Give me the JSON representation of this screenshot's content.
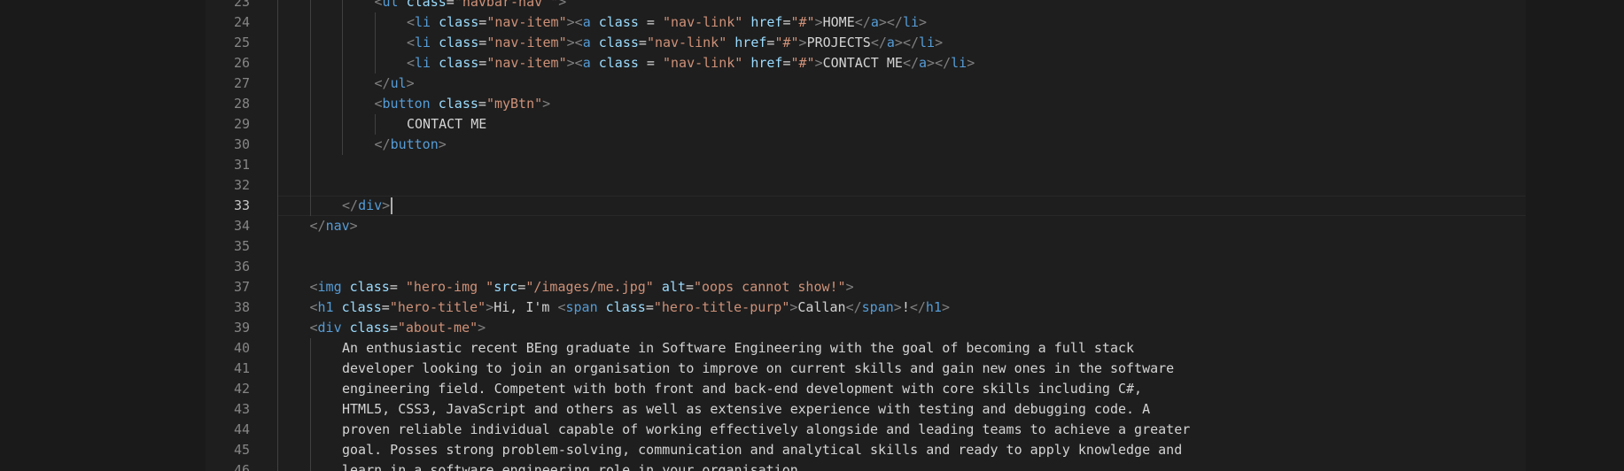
{
  "theme": {
    "background": "#1e1e1e",
    "side_background": "#1a1a1a",
    "line_number": "#858585",
    "line_number_active": "#c6c6c6",
    "indent_guide": "#404040",
    "colors": {
      "p": "#808080",
      "t": "#569cd6",
      "a": "#9cdcfe",
      "s": "#ce9178",
      "x": "#d4d4d4"
    }
  },
  "editor": {
    "active_line": "33",
    "lines": [
      {
        "num": "23",
        "indent": 3,
        "tokens": [
          [
            "p",
            "<"
          ],
          [
            "t",
            "ul"
          ],
          [
            "x",
            " "
          ],
          [
            "a",
            "class"
          ],
          [
            "x",
            "="
          ],
          [
            "s",
            "\"navbar-nav \""
          ],
          [
            "p",
            ">"
          ]
        ]
      },
      {
        "num": "24",
        "indent": 4,
        "tokens": [
          [
            "p",
            "<"
          ],
          [
            "t",
            "li"
          ],
          [
            "x",
            " "
          ],
          [
            "a",
            "class"
          ],
          [
            "x",
            "="
          ],
          [
            "s",
            "\"nav-item\""
          ],
          [
            "p",
            ">"
          ],
          [
            "p",
            "<"
          ],
          [
            "t",
            "a"
          ],
          [
            "x",
            " "
          ],
          [
            "a",
            "class"
          ],
          [
            "x",
            " = "
          ],
          [
            "s",
            "\"nav-link\""
          ],
          [
            "x",
            " "
          ],
          [
            "a",
            "href"
          ],
          [
            "x",
            "="
          ],
          [
            "s",
            "\"#\""
          ],
          [
            "p",
            ">"
          ],
          [
            "x",
            "HOME"
          ],
          [
            "p",
            "</"
          ],
          [
            "t",
            "a"
          ],
          [
            "p",
            ">"
          ],
          [
            "p",
            "</"
          ],
          [
            "t",
            "li"
          ],
          [
            "p",
            ">"
          ]
        ]
      },
      {
        "num": "25",
        "indent": 4,
        "tokens": [
          [
            "p",
            "<"
          ],
          [
            "t",
            "li"
          ],
          [
            "x",
            " "
          ],
          [
            "a",
            "class"
          ],
          [
            "x",
            "="
          ],
          [
            "s",
            "\"nav-item\""
          ],
          [
            "p",
            ">"
          ],
          [
            "p",
            "<"
          ],
          [
            "t",
            "a"
          ],
          [
            "x",
            " "
          ],
          [
            "a",
            "class"
          ],
          [
            "x",
            "="
          ],
          [
            "s",
            "\"nav-link\""
          ],
          [
            "x",
            " "
          ],
          [
            "a",
            "href"
          ],
          [
            "x",
            "="
          ],
          [
            "s",
            "\"#\""
          ],
          [
            "p",
            ">"
          ],
          [
            "x",
            "PROJECTS"
          ],
          [
            "p",
            "</"
          ],
          [
            "t",
            "a"
          ],
          [
            "p",
            ">"
          ],
          [
            "p",
            "</"
          ],
          [
            "t",
            "li"
          ],
          [
            "p",
            ">"
          ]
        ]
      },
      {
        "num": "26",
        "indent": 4,
        "tokens": [
          [
            "p",
            "<"
          ],
          [
            "t",
            "li"
          ],
          [
            "x",
            " "
          ],
          [
            "a",
            "class"
          ],
          [
            "x",
            "="
          ],
          [
            "s",
            "\"nav-item\""
          ],
          [
            "p",
            ">"
          ],
          [
            "p",
            "<"
          ],
          [
            "t",
            "a"
          ],
          [
            "x",
            " "
          ],
          [
            "a",
            "class"
          ],
          [
            "x",
            " = "
          ],
          [
            "s",
            "\"nav-link\""
          ],
          [
            "x",
            " "
          ],
          [
            "a",
            "href"
          ],
          [
            "x",
            "="
          ],
          [
            "s",
            "\"#\""
          ],
          [
            "p",
            ">"
          ],
          [
            "x",
            "CONTACT ME"
          ],
          [
            "p",
            "</"
          ],
          [
            "t",
            "a"
          ],
          [
            "p",
            ">"
          ],
          [
            "p",
            "</"
          ],
          [
            "t",
            "li"
          ],
          [
            "p",
            ">"
          ]
        ]
      },
      {
        "num": "27",
        "indent": 3,
        "tokens": [
          [
            "p",
            "</"
          ],
          [
            "t",
            "ul"
          ],
          [
            "p",
            ">"
          ]
        ]
      },
      {
        "num": "28",
        "indent": 3,
        "tokens": [
          [
            "p",
            "<"
          ],
          [
            "t",
            "button"
          ],
          [
            "x",
            " "
          ],
          [
            "a",
            "class"
          ],
          [
            "x",
            "="
          ],
          [
            "s",
            "\"myBtn\""
          ],
          [
            "p",
            ">"
          ]
        ]
      },
      {
        "num": "29",
        "indent": 4,
        "tokens": [
          [
            "x",
            "CONTACT ME"
          ]
        ]
      },
      {
        "num": "30",
        "indent": 3,
        "tokens": [
          [
            "p",
            "</"
          ],
          [
            "t",
            "button"
          ],
          [
            "p",
            ">"
          ]
        ]
      },
      {
        "num": "31",
        "indent": 0,
        "tokens": []
      },
      {
        "num": "32",
        "indent": 0,
        "tokens": []
      },
      {
        "num": "33",
        "indent": 2,
        "tokens": [
          [
            "p",
            "</"
          ],
          [
            "t",
            "div"
          ],
          [
            "p",
            ">"
          ]
        ]
      },
      {
        "num": "34",
        "indent": 1,
        "tokens": [
          [
            "p",
            "</"
          ],
          [
            "t",
            "nav"
          ],
          [
            "p",
            ">"
          ]
        ]
      },
      {
        "num": "35",
        "indent": 0,
        "tokens": []
      },
      {
        "num": "36",
        "indent": 0,
        "tokens": []
      },
      {
        "num": "37",
        "indent": 1,
        "tokens": [
          [
            "p",
            "<"
          ],
          [
            "t",
            "img"
          ],
          [
            "x",
            " "
          ],
          [
            "a",
            "class"
          ],
          [
            "x",
            "= "
          ],
          [
            "s",
            "\"hero-img \""
          ],
          [
            "a",
            "src"
          ],
          [
            "x",
            "="
          ],
          [
            "s",
            "\"/images/me.jpg\""
          ],
          [
            "x",
            " "
          ],
          [
            "a",
            "alt"
          ],
          [
            "x",
            "="
          ],
          [
            "s",
            "\"oops cannot show!\""
          ],
          [
            "p",
            ">"
          ]
        ]
      },
      {
        "num": "38",
        "indent": 1,
        "tokens": [
          [
            "p",
            "<"
          ],
          [
            "t",
            "h1"
          ],
          [
            "x",
            " "
          ],
          [
            "a",
            "class"
          ],
          [
            "x",
            "="
          ],
          [
            "s",
            "\"hero-title\""
          ],
          [
            "p",
            ">"
          ],
          [
            "x",
            "Hi, I'm "
          ],
          [
            "p",
            "<"
          ],
          [
            "t",
            "span"
          ],
          [
            "x",
            " "
          ],
          [
            "a",
            "class"
          ],
          [
            "x",
            "="
          ],
          [
            "s",
            "\"hero-title-purp\""
          ],
          [
            "p",
            ">"
          ],
          [
            "x",
            "Callan"
          ],
          [
            "p",
            "</"
          ],
          [
            "t",
            "span"
          ],
          [
            "p",
            ">"
          ],
          [
            "x",
            "!"
          ],
          [
            "p",
            "</"
          ],
          [
            "t",
            "h1"
          ],
          [
            "p",
            ">"
          ]
        ]
      },
      {
        "num": "39",
        "indent": 1,
        "tokens": [
          [
            "p",
            "<"
          ],
          [
            "t",
            "div"
          ],
          [
            "x",
            " "
          ],
          [
            "a",
            "class"
          ],
          [
            "x",
            "="
          ],
          [
            "s",
            "\"about-me\""
          ],
          [
            "p",
            ">"
          ]
        ]
      },
      {
        "num": "40",
        "indent": 2,
        "tokens": [
          [
            "x",
            "An enthusiastic recent BEng graduate in Software Engineering with the goal of becoming a full stack"
          ]
        ]
      },
      {
        "num": "41",
        "indent": 2,
        "tokens": [
          [
            "x",
            "developer looking to join an organisation to improve on current skills and gain new ones in the software"
          ]
        ]
      },
      {
        "num": "42",
        "indent": 2,
        "tokens": [
          [
            "x",
            "engineering field. Competent with both front and back-end development with core skills including C#,"
          ]
        ]
      },
      {
        "num": "43",
        "indent": 2,
        "tokens": [
          [
            "x",
            "HTML5, CSS3, JavaScript and others as well as extensive experience with testing and debugging code. A"
          ]
        ]
      },
      {
        "num": "44",
        "indent": 2,
        "tokens": [
          [
            "x",
            "proven reliable individual capable of working effectively alongside and leading teams to achieve a greater"
          ]
        ]
      },
      {
        "num": "45",
        "indent": 2,
        "tokens": [
          [
            "x",
            "goal. Posses strong problem-solving, communication and analytical skills and ready to apply knowledge and"
          ]
        ]
      },
      {
        "num": "46",
        "indent": 2,
        "tokens": [
          [
            "x",
            "learn in a software engineering role in your organisation."
          ]
        ]
      }
    ]
  }
}
